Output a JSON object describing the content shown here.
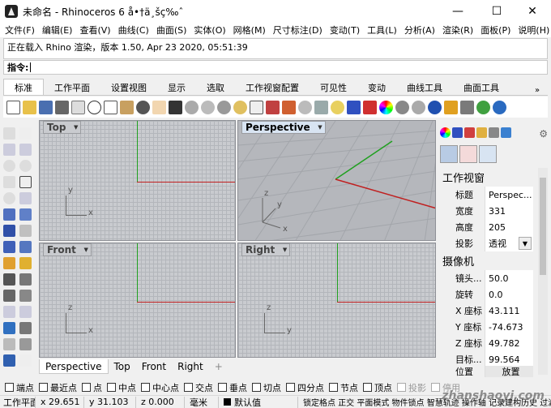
{
  "window": {
    "title": "未命名 - Rhinoceros 6 å•†ä¸šç‰ˆ",
    "minimize": "—",
    "maximize": "☐",
    "close": "✕"
  },
  "menu": [
    "文件(F)",
    "编辑(E)",
    "查看(V)",
    "曲线(C)",
    "曲面(S)",
    "实体(O)",
    "网格(M)",
    "尺寸标注(D)",
    "变动(T)",
    "工具(L)",
    "分析(A)",
    "渲染(R)",
    "面板(P)",
    "说明(H)"
  ],
  "history": {
    "line": "正在载入 Rhino 渲染，版本 1.50, Apr 23 2020, 05:51:39"
  },
  "command": {
    "prompt": "指令:"
  },
  "tabs": [
    "标准",
    "工作平面",
    "设置视图",
    "显示",
    "选取",
    "工作视窗配置",
    "可见性",
    "变动",
    "曲线工具",
    "曲面工具"
  ],
  "tabs_more": "»",
  "viewports": {
    "top": "Top",
    "perspective": "Perspective",
    "front": "Front",
    "right": "Right"
  },
  "axis": {
    "top": {
      "v": "y",
      "h": "x"
    },
    "front": {
      "v": "z",
      "h": "x"
    },
    "right": {
      "v": "z",
      "h": "y"
    },
    "perspective": {
      "v": "z",
      "a": "y",
      "h": "x"
    }
  },
  "viewport_tabs": [
    "Perspective",
    "Top",
    "Front",
    "Right"
  ],
  "viewport_tab_add": "+",
  "panel": {
    "section1": "工作视窗",
    "props1": [
      {
        "k": "标题",
        "v": "Perspec..."
      },
      {
        "k": "宽度",
        "v": "331"
      },
      {
        "k": "高度",
        "v": "205"
      },
      {
        "k": "投影",
        "v": "透视"
      }
    ],
    "section2": "摄像机",
    "props2": [
      {
        "k": "镜头...",
        "v": "50.0"
      },
      {
        "k": "旋转",
        "v": "0.0"
      },
      {
        "k": "X 座标",
        "v": "43.111"
      },
      {
        "k": "Y 座标",
        "v": "-74.673"
      },
      {
        "k": "Z 座标",
        "v": "49.782"
      },
      {
        "k": "目标...",
        "v": "99.564"
      },
      {
        "k": "位置",
        "v": "放置"
      }
    ]
  },
  "osnaps": [
    {
      "label": "端点",
      "enabled": true
    },
    {
      "label": "最近点",
      "enabled": true
    },
    {
      "label": "点",
      "enabled": true
    },
    {
      "label": "中点",
      "enabled": true
    },
    {
      "label": "中心点",
      "enabled": true
    },
    {
      "label": "交点",
      "enabled": true
    },
    {
      "label": "垂点",
      "enabled": true
    },
    {
      "label": "切点",
      "enabled": true
    },
    {
      "label": "四分点",
      "enabled": true
    },
    {
      "label": "节点",
      "enabled": true
    },
    {
      "label": "顶点",
      "enabled": true
    },
    {
      "label": "投影",
      "enabled": false
    },
    {
      "label": "停用",
      "enabled": false
    }
  ],
  "status": {
    "cplane": "工作平面",
    "x": "x 29.651",
    "y": "y 31.103",
    "z": "z 0.000",
    "units": "毫米",
    "layer": "默认值",
    "modes": "锁定格点 正交 平面模式 物件锁点 智慧轨迹 操作轴 记录建构历史 过滤器"
  },
  "watermark": "zhanshaoyi.com"
}
